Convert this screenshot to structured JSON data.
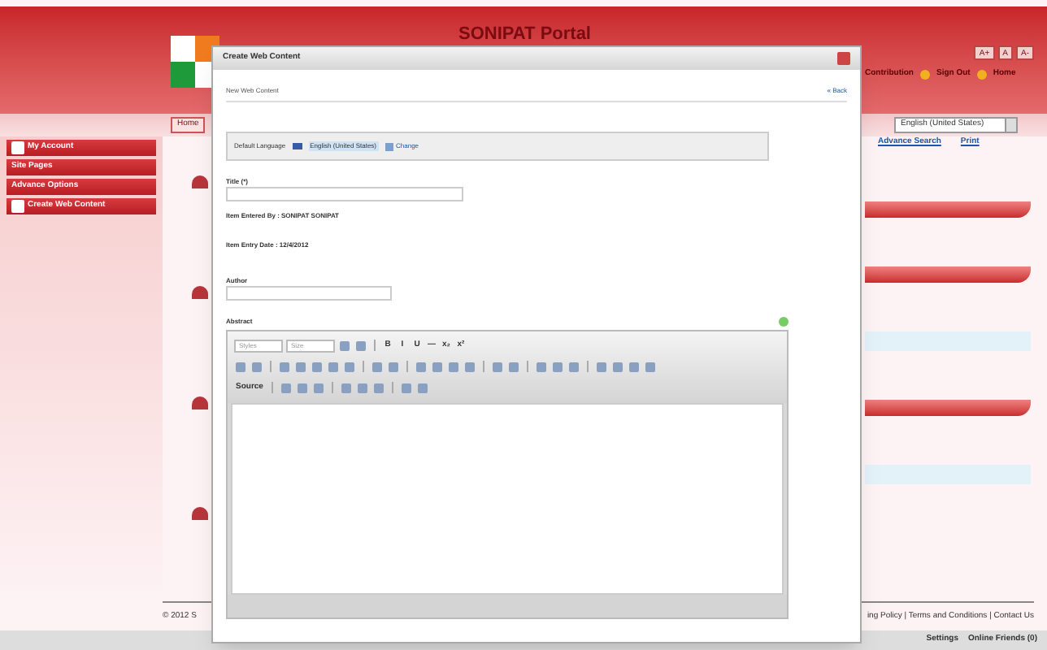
{
  "header": {
    "title": "SONIPAT Portal",
    "tabs": [
      {
        "label": "Home",
        "selected": true
      }
    ],
    "user_links": [
      "Contribution",
      "Sign Out",
      "Home"
    ],
    "font_buttons": [
      "A+",
      "A",
      "A-"
    ],
    "language_select": "English (United States)",
    "page_links": [
      "Advance Search",
      "Print"
    ]
  },
  "sidebar": {
    "items": [
      {
        "label": "My Account",
        "kind": "icon"
      },
      {
        "label": "Site Pages",
        "kind": "plain"
      },
      {
        "label": "Advance Options",
        "kind": "plain"
      },
      {
        "label": "Create Web Content",
        "kind": "icon"
      }
    ]
  },
  "footer": {
    "copyright": "© 2012 S",
    "links": "ing Policy | Terms and Conditions | Contact Us"
  },
  "bottom_bar": [
    "Settings",
    "Online Friends (0)"
  ],
  "dialog": {
    "title": "Create Web Content",
    "heading": "New Web Content",
    "back_link": "« Back",
    "default_language_label": "Default Language",
    "language": "English (United States)",
    "change_link": "Change",
    "title_label": "Title (*)",
    "entered_by": "Item Entered By : SONIPAT SONIPAT",
    "entry_date": "Item Entry Date : 12/4/2012",
    "author_label": "Author",
    "abstract_label": "Abstract",
    "toolbar": [
      [
        {
          "kind": "combo",
          "label": "Styles"
        },
        {
          "kind": "combo",
          "label": "Size"
        },
        {
          "kind": "icon"
        },
        {
          "kind": "icon"
        },
        {
          "kind": "gap"
        },
        {
          "kind": "text",
          "label": "B"
        },
        {
          "kind": "text",
          "label": "I"
        },
        {
          "kind": "text",
          "label": "U"
        },
        {
          "kind": "text",
          "label": "—"
        },
        {
          "kind": "text",
          "label": "x₂"
        },
        {
          "kind": "text",
          "label": "x²"
        }
      ],
      [
        {
          "kind": "icon"
        },
        {
          "kind": "icon"
        },
        {
          "kind": "gap"
        },
        {
          "kind": "icon"
        },
        {
          "kind": "icon"
        },
        {
          "kind": "icon"
        },
        {
          "kind": "icon"
        },
        {
          "kind": "icon"
        },
        {
          "kind": "gap"
        },
        {
          "kind": "icon"
        },
        {
          "kind": "icon"
        },
        {
          "kind": "gap"
        },
        {
          "kind": "icon"
        },
        {
          "kind": "icon"
        },
        {
          "kind": "icon"
        },
        {
          "kind": "icon"
        },
        {
          "kind": "gap"
        },
        {
          "kind": "icon"
        },
        {
          "kind": "icon"
        },
        {
          "kind": "gap"
        },
        {
          "kind": "icon"
        },
        {
          "kind": "icon"
        },
        {
          "kind": "icon"
        },
        {
          "kind": "gap"
        },
        {
          "kind": "icon"
        },
        {
          "kind": "icon"
        },
        {
          "kind": "icon"
        },
        {
          "kind": "icon"
        }
      ],
      [
        {
          "kind": "text",
          "label": "Source"
        },
        {
          "kind": "gap"
        },
        {
          "kind": "icon"
        },
        {
          "kind": "icon"
        },
        {
          "kind": "icon"
        },
        {
          "kind": "gap"
        },
        {
          "kind": "icon"
        },
        {
          "kind": "icon"
        },
        {
          "kind": "icon"
        },
        {
          "kind": "gap"
        },
        {
          "kind": "icon"
        },
        {
          "kind": "icon"
        }
      ]
    ]
  }
}
